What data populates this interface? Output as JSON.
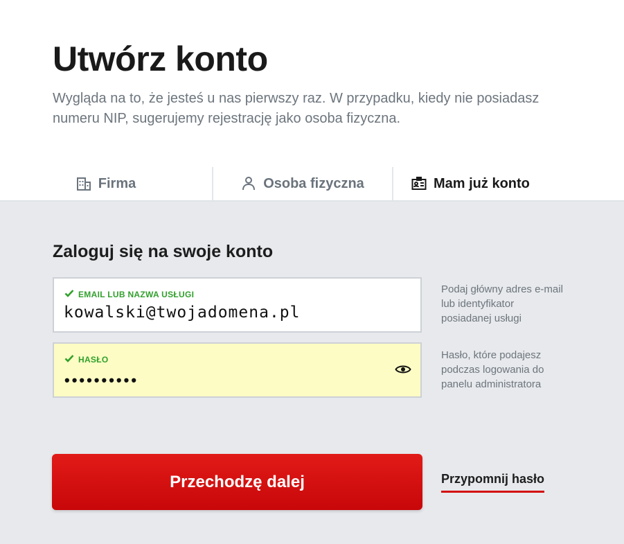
{
  "header": {
    "title": "Utwórz konto",
    "subtitle": "Wygląda na to, że jesteś u nas pierwszy raz. W przypadku, kiedy nie posiadasz numeru NIP, sugerujemy rejestrację jako osoba fizyczna."
  },
  "tabs": [
    {
      "label": "Firma",
      "icon": "building-icon",
      "active": false
    },
    {
      "label": "Osoba fizyczna",
      "icon": "person-icon",
      "active": false
    },
    {
      "label": "Mam już konto",
      "icon": "id-card-icon",
      "active": true
    }
  ],
  "login": {
    "title": "Zaloguj się na swoje konto",
    "email": {
      "label": "EMAIL LUB NAZWA USŁUGI",
      "value": "kowalski@twojadomena.pl",
      "hint": "Podaj główny adres e-mail lub identyfikator posiadanej usługi",
      "valid": true
    },
    "password": {
      "label": "HASŁO",
      "masked_value": "••••••••••",
      "hint": "Hasło, które podajesz podczas logowania do panelu administratora",
      "valid": true
    },
    "submit_label": "Przechodzę dalej",
    "remind_label": "Przypomnij hasło"
  },
  "colors": {
    "accent_red": "#d40c0e",
    "valid_green": "#31a02c",
    "panel_bg": "#e7e9ec",
    "autofill_yellow": "#fcfcc4"
  }
}
